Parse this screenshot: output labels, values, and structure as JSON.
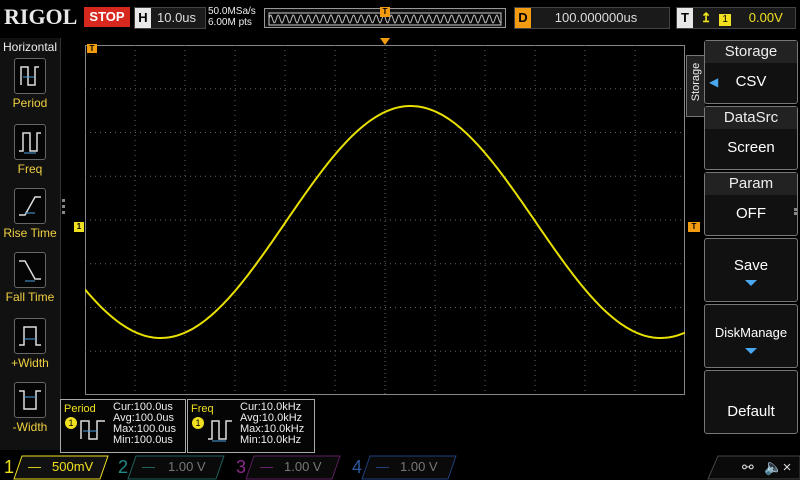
{
  "top": {
    "logo": "RIGOL",
    "run_state": "STOP",
    "horizontal_key": "H",
    "timebase": "10.0us",
    "sample_rate": "50.0MSa/s",
    "memory_depth": "6.00M pts",
    "trigger_pos_key": "T",
    "delay_key": "D",
    "delay": "100.000000us",
    "trigger_key": "T",
    "trigger_source": "1",
    "trigger_level": "0.00V"
  },
  "left_menu": {
    "title": "Horizontal",
    "items": [
      {
        "label": "Period",
        "icon": "period-icon"
      },
      {
        "label": "Freq",
        "icon": "freq-icon"
      },
      {
        "label": "Rise Time",
        "icon": "rise-time-icon"
      },
      {
        "label": "Fall Time",
        "icon": "fall-time-icon"
      },
      {
        "label": "+Width",
        "icon": "pos-width-icon"
      },
      {
        "label": "-Width",
        "icon": "neg-width-icon"
      }
    ]
  },
  "markers": {
    "trigger_top": "T",
    "ch1_level": "1",
    "trigger_level_right": "T"
  },
  "waveform": {
    "color": "#e8e000",
    "grid_color": "#666666"
  },
  "right_menu": {
    "side_label": "Storage",
    "items": [
      {
        "head": "Storage",
        "value": "CSV"
      },
      {
        "head": "DataSrc",
        "value": "Screen"
      },
      {
        "head": "Param",
        "value": "OFF"
      },
      {
        "head": "",
        "value": "Save"
      },
      {
        "head": "",
        "value": "DiskManage"
      },
      {
        "head": "",
        "value": "Default"
      }
    ]
  },
  "measurements": [
    {
      "name": "Period",
      "channel": "1",
      "cur": "Cur:100.0us",
      "avg": "Avg:100.0us",
      "max": "Max:100.0us",
      "min": "Min:100.0us"
    },
    {
      "name": "Freq",
      "channel": "1",
      "cur": "Cur:10.0kHz",
      "avg": "Avg:10.0kHz",
      "max": "Max:10.0kHz",
      "min": "Min:10.0kHz"
    }
  ],
  "channels": [
    {
      "num": "1",
      "scale": "500mV",
      "color": "#f0e020",
      "active": true
    },
    {
      "num": "2",
      "scale": "1.00 V",
      "color": "#1fa3a0",
      "active": false
    },
    {
      "num": "3",
      "scale": "1.00 V",
      "color": "#c030c0",
      "active": false
    },
    {
      "num": "4",
      "scale": "1.00 V",
      "color": "#2f6fd0",
      "active": false
    }
  ]
}
